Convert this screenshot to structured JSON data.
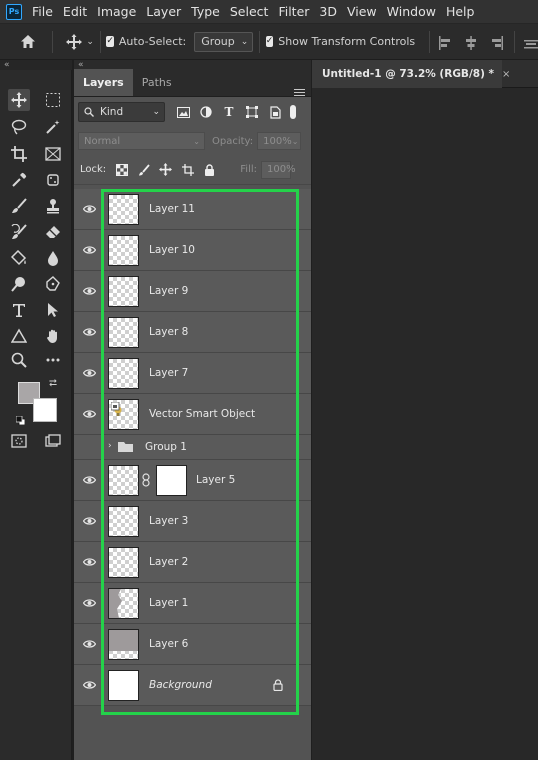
{
  "menubar": {
    "logo": "Ps",
    "items": [
      "File",
      "Edit",
      "Image",
      "Layer",
      "Type",
      "Select",
      "Filter",
      "3D",
      "View",
      "Window",
      "Help"
    ]
  },
  "options_bar": {
    "auto_select_label": "Auto-Select:",
    "auto_select_value": "Group",
    "transform_controls_label": "Show Transform Controls"
  },
  "layers_panel": {
    "tabs": [
      "Layers",
      "Paths"
    ],
    "kind_label": "Kind",
    "blend_mode": "Normal",
    "opacity_label": "Opacity:",
    "opacity_value": "100%",
    "lock_label": "Lock:",
    "fill_label": "Fill:",
    "fill_value": "100%",
    "layers": [
      {
        "name": "Layer 11",
        "thumb": "transparent"
      },
      {
        "name": "Layer 10",
        "thumb": "transparent"
      },
      {
        "name": "Layer 9",
        "thumb": "transparent"
      },
      {
        "name": "Layer 8",
        "thumb": "transparent"
      },
      {
        "name": "Layer 7",
        "thumb": "transparent"
      },
      {
        "name": "Vector Smart Object",
        "thumb": "smart"
      },
      {
        "name": "Group 1",
        "thumb": "folder"
      },
      {
        "name": "Layer 5",
        "thumb": "transparent-mask"
      },
      {
        "name": "Layer 3",
        "thumb": "transparent"
      },
      {
        "name": "Layer 2",
        "thumb": "transparent"
      },
      {
        "name": "Layer 1",
        "thumb": "partial"
      },
      {
        "name": "Layer 6",
        "thumb": "gray"
      },
      {
        "name": "Background",
        "thumb": "white"
      }
    ]
  },
  "document": {
    "tab_title": "Untitled-1 @ 73.2% (RGB/8) *",
    "close_glyph": "×"
  },
  "colors": {
    "foreground": "#a9a6a7",
    "background": "#ffffff",
    "highlight": "#24d24a"
  }
}
